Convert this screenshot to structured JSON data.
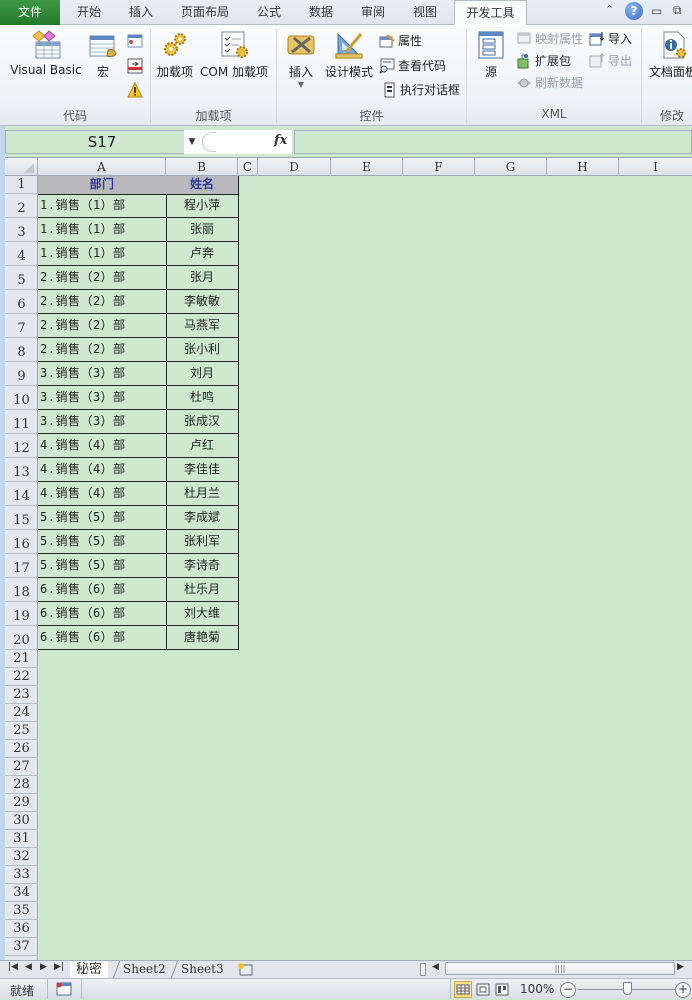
{
  "ribbon_tabs": [
    {
      "label": "文件",
      "state": "file"
    },
    {
      "label": "开始",
      "state": "normal"
    },
    {
      "label": "插入",
      "state": "normal"
    },
    {
      "label": "页面布局",
      "state": "normal"
    },
    {
      "label": "公式",
      "state": "normal"
    },
    {
      "label": "数据",
      "state": "normal"
    },
    {
      "label": "审阅",
      "state": "normal"
    },
    {
      "label": "视图",
      "state": "normal"
    },
    {
      "label": "开发工具",
      "state": "active"
    }
  ],
  "window_controls": {
    "collapse": "⌃",
    "help": "?",
    "minimize": "▭",
    "restore": "⧉"
  },
  "ribbon": {
    "groups": {
      "code": {
        "label": "代码",
        "visual_basic": "Visual Basic",
        "macro": "宏"
      },
      "addins": {
        "label": "加载项",
        "addins_btn": "加载项",
        "com_addins": "COM 加载项"
      },
      "controls": {
        "label": "控件",
        "insert": "插入",
        "design_mode": "设计模式",
        "properties": "属性",
        "view_code": "查看代码",
        "run_dialog": "执行对话框"
      },
      "xml": {
        "label": "XML",
        "source": "源",
        "map_properties": "映射属性",
        "expansion_packs": "扩展包",
        "refresh_data": "刷新数据",
        "import": "导入",
        "export": "导出"
      },
      "modify": {
        "label": "修改",
        "document_panel": "文档面板"
      }
    }
  },
  "formula_bar": {
    "name_box": "S17",
    "fx_label": "fx",
    "formula": ""
  },
  "columns": [
    "A",
    "B",
    "C",
    "D",
    "E",
    "F",
    "G",
    "H",
    "I"
  ],
  "table": {
    "headers": [
      "部门",
      "姓名"
    ],
    "rows": [
      [
        "1.销售（1）部",
        "程小萍"
      ],
      [
        "1.销售（1）部",
        "张丽"
      ],
      [
        "1.销售（1）部",
        "卢奔"
      ],
      [
        "2.销售（2）部",
        "张月"
      ],
      [
        "2.销售（2）部",
        "李敏敏"
      ],
      [
        "2.销售（2）部",
        "马燕军"
      ],
      [
        "2.销售（2）部",
        "张小利"
      ],
      [
        "3.销售（3）部",
        "刘月"
      ],
      [
        "3.销售（3）部",
        "杜鸣"
      ],
      [
        "3.销售（3）部",
        "张成汉"
      ],
      [
        "4.销售（4）部",
        "卢红"
      ],
      [
        "4.销售（4）部",
        "李佳佳"
      ],
      [
        "4.销售（4）部",
        "杜月兰"
      ],
      [
        "5.销售（5）部",
        "李成斌"
      ],
      [
        "5.销售（5）部",
        "张利军"
      ],
      [
        "5.销售（5）部",
        "李诗奇"
      ],
      [
        "6.销售（6）部",
        "杜乐月"
      ],
      [
        "6.销售（6）部",
        "刘大维"
      ],
      [
        "6.销售（6）部",
        "唐艳菊"
      ]
    ]
  },
  "row_numbers": [
    "1",
    "2",
    "3",
    "4",
    "5",
    "6",
    "7",
    "8",
    "9",
    "10",
    "11",
    "12",
    "13",
    "14",
    "15",
    "16",
    "17",
    "18",
    "19",
    "20",
    "21",
    "22",
    "23",
    "24",
    "25",
    "26",
    "27",
    "28",
    "29",
    "30",
    "31",
    "32",
    "33",
    "34",
    "35",
    "36",
    "37"
  ],
  "sheet_tabs": [
    {
      "label": "秘密",
      "active": true
    },
    {
      "label": "Sheet2",
      "active": false
    },
    {
      "label": "Sheet3",
      "active": false
    }
  ],
  "status_bar": {
    "ready": "就绪",
    "zoom": "100%",
    "zoom_out": "−",
    "zoom_in": "+",
    "zoom_level_percent": 100
  },
  "colors": {
    "sheet_bg": "#cde8cf",
    "header_fill": "#b9b9bd",
    "header_text": "#2e3a9e",
    "file_tab": "#2e8b35"
  }
}
